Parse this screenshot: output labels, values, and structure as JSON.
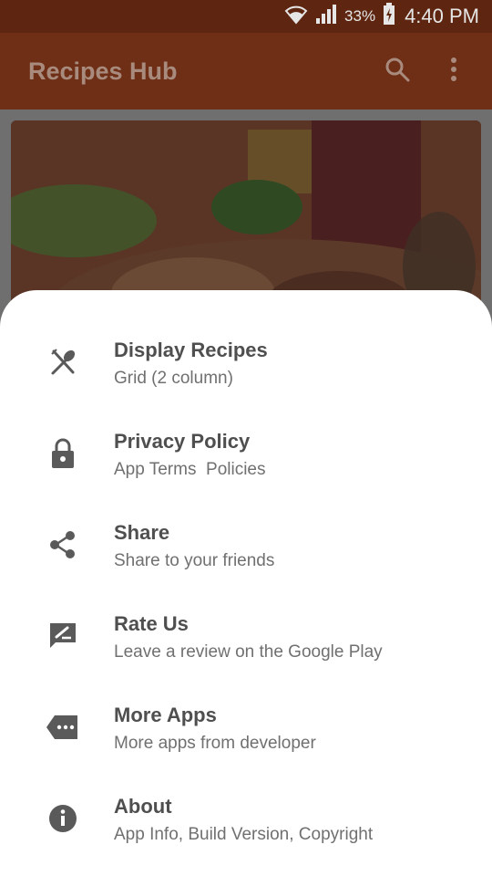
{
  "status_bar": {
    "battery": "33%",
    "time": "4:40 PM"
  },
  "app_bar": {
    "title": "Recipes Hub",
    "icons": [
      "search-icon",
      "more-vert-icon"
    ]
  },
  "colors": {
    "status_bar_bg": "#5e2510",
    "app_bar_bg": "#6e2f16",
    "sheet_bg": "#ffffff",
    "title_text": "#4f4f4f",
    "subtitle_text": "#707070",
    "icon": "#5a5a5a"
  },
  "menu": {
    "items": [
      {
        "icon": "utensils-icon",
        "title": "Display Recipes",
        "subtitle": "Grid (2 column)"
      },
      {
        "icon": "lock-icon",
        "title": "Privacy Policy",
        "subtitle": "App Terms  Policies"
      },
      {
        "icon": "share-icon",
        "title": "Share",
        "subtitle": "Share to your friends"
      },
      {
        "icon": "rate-review-icon",
        "title": "Rate Us",
        "subtitle": "Leave a review on the Google Play"
      },
      {
        "icon": "more-apps-icon",
        "title": "More Apps",
        "subtitle": "More apps from developer"
      },
      {
        "icon": "info-icon",
        "title": "About",
        "subtitle": "App Info, Build Version, Copyright"
      }
    ]
  }
}
